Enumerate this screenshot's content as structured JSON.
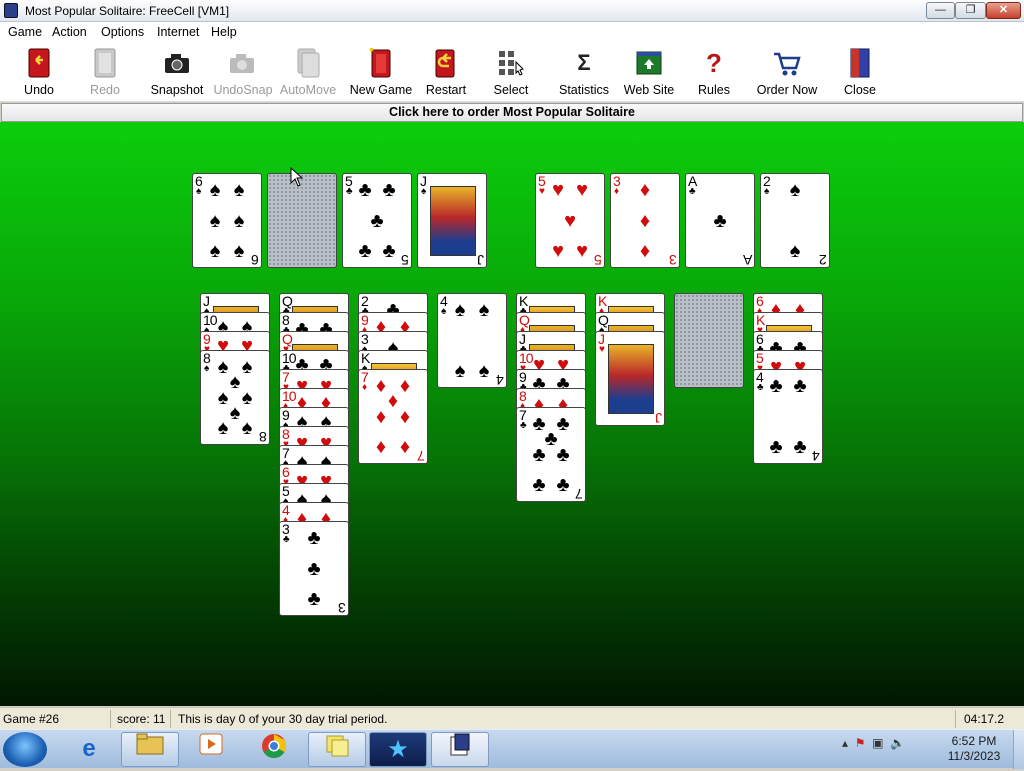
{
  "window": {
    "title": "Most Popular Solitaire: FreeCell [VM1]"
  },
  "menu": [
    "Game",
    "Action",
    "Options",
    "Internet",
    "Help"
  ],
  "toolbar": {
    "undo": "Undo",
    "redo": "Redo",
    "snapshot": "Snapshot",
    "undosnap": "UndoSnap",
    "automove": "AutoMove",
    "new_game": "New Game",
    "restart": "Restart",
    "select": "Select",
    "statistics": "Statistics",
    "web_site": "Web Site",
    "rules": "Rules",
    "order_now": "Order Now",
    "close": "Close"
  },
  "order_banner": "Click here to order Most Popular Solitaire",
  "colors": {
    "felt_top": "#0ccd0c",
    "felt_bottom": "#011701",
    "red_suit": "#d10c0c"
  },
  "game": {
    "free_cells": [
      {
        "rank": "6",
        "suit": "♠"
      },
      {
        "rank": "",
        "suit": "",
        "empty": true
      },
      {
        "rank": "5",
        "suit": "♣"
      },
      {
        "rank": "J",
        "suit": "♠",
        "court": true
      }
    ],
    "foundations": [
      {
        "rank": "5",
        "suit": "♥"
      },
      {
        "rank": "3",
        "suit": "♦"
      },
      {
        "rank": "A",
        "suit": "♣"
      },
      {
        "rank": "2",
        "suit": "♠"
      }
    ],
    "tableau": [
      [
        {
          "rank": "J",
          "suit": "♠"
        },
        {
          "rank": "10",
          "suit": "♠"
        },
        {
          "rank": "9",
          "suit": "♥"
        },
        {
          "rank": "8",
          "suit": "♠"
        }
      ],
      [
        {
          "rank": "Q",
          "suit": "♣"
        },
        {
          "rank": "8",
          "suit": "♣"
        },
        {
          "rank": "Q",
          "suit": "♥"
        },
        {
          "rank": "10",
          "suit": "♣"
        },
        {
          "rank": "7",
          "suit": "♥"
        },
        {
          "rank": "10",
          "suit": "♦"
        },
        {
          "rank": "9",
          "suit": "♠"
        },
        {
          "rank": "8",
          "suit": "♥"
        },
        {
          "rank": "7",
          "suit": "♠"
        },
        {
          "rank": "6",
          "suit": "♥"
        },
        {
          "rank": "5",
          "suit": "♠"
        },
        {
          "rank": "4",
          "suit": "♦"
        },
        {
          "rank": "3",
          "suit": "♣"
        }
      ],
      [
        {
          "rank": "2",
          "suit": "♣"
        },
        {
          "rank": "9",
          "suit": "♦"
        },
        {
          "rank": "3",
          "suit": "♠"
        },
        {
          "rank": "K",
          "suit": "♠"
        },
        {
          "rank": "7",
          "suit": "♦"
        }
      ],
      [
        {
          "rank": "4",
          "suit": "♠"
        }
      ],
      [
        {
          "rank": "K",
          "suit": "♣"
        },
        {
          "rank": "Q",
          "suit": "♦"
        },
        {
          "rank": "J",
          "suit": "♣"
        },
        {
          "rank": "10",
          "suit": "♥"
        },
        {
          "rank": "9",
          "suit": "♣"
        },
        {
          "rank": "8",
          "suit": "♦"
        },
        {
          "rank": "7",
          "suit": "♣"
        }
      ],
      [
        {
          "rank": "K",
          "suit": "♦"
        },
        {
          "rank": "Q",
          "suit": "♠"
        },
        {
          "rank": "J",
          "suit": "♥"
        }
      ],
      [],
      [
        {
          "rank": "6",
          "suit": "♦"
        },
        {
          "rank": "K",
          "suit": "♥"
        },
        {
          "rank": "6",
          "suit": "♣"
        },
        {
          "rank": "5",
          "suit": "♥"
        },
        {
          "rank": "4",
          "suit": "♣"
        }
      ]
    ]
  },
  "status": {
    "game": "Game #26",
    "score": "score: 11",
    "message": "This is day 0 of your 30 day trial period.",
    "timer": "04:17.2"
  },
  "taskbar": {
    "time": "6:52 PM",
    "date": "11/3/2023"
  }
}
